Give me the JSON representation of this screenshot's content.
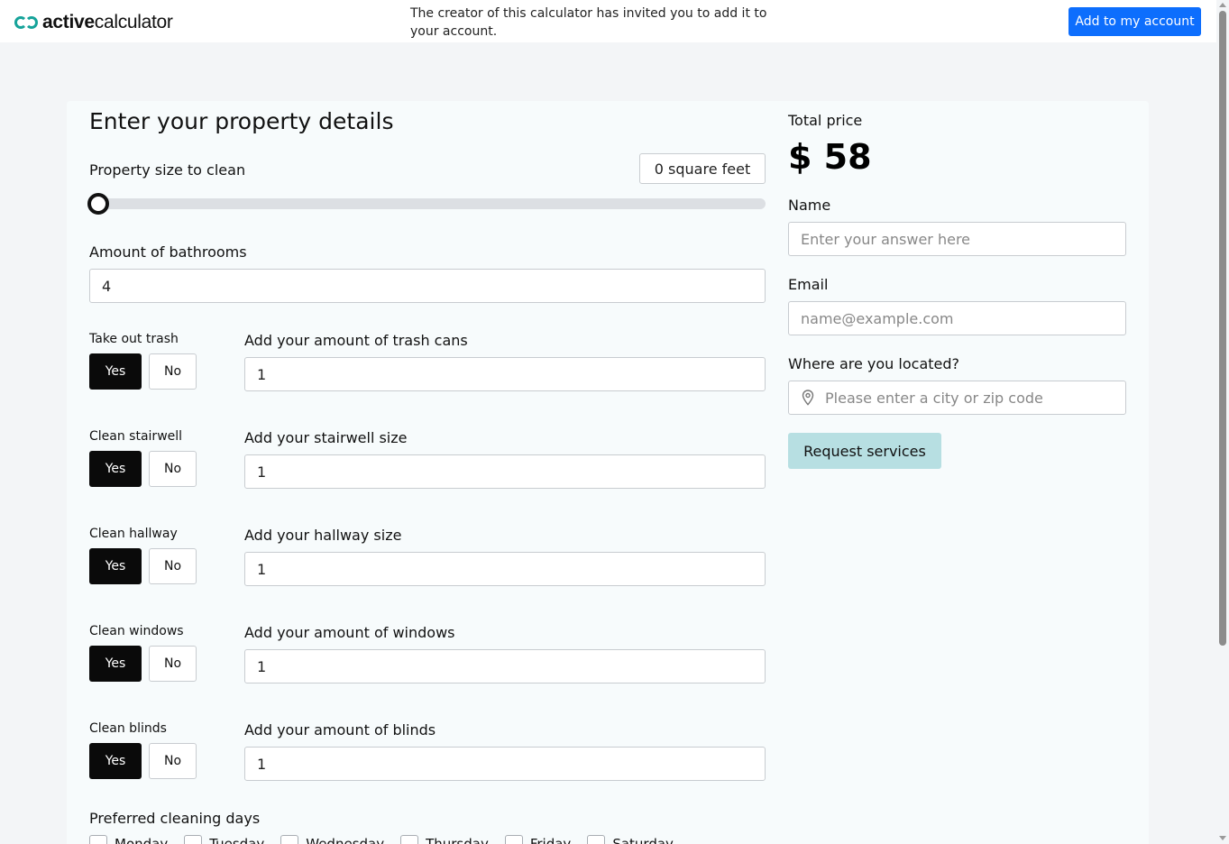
{
  "topbar": {
    "logo_bold": "active",
    "logo_light": "calculator",
    "notice": "The creator of this calculator has invited you to add it to your account.",
    "add_button": "Add to my account"
  },
  "form": {
    "heading": "Enter your property details",
    "property_size": {
      "label": "Property size to clean",
      "value": "0 square feet",
      "slider_fraction": 0
    },
    "bathrooms": {
      "label": "Amount of bathrooms",
      "value": "4"
    },
    "toggles": [
      {
        "question": "Take out trash",
        "yes": "Yes",
        "no": "No",
        "selected": "Yes",
        "field_label": "Add your amount of trash cans",
        "field_value": "1"
      },
      {
        "question": "Clean stairwell",
        "yes": "Yes",
        "no": "No",
        "selected": "Yes",
        "field_label": "Add your stairwell size",
        "field_value": "1"
      },
      {
        "question": "Clean hallway",
        "yes": "Yes",
        "no": "No",
        "selected": "Yes",
        "field_label": "Add your hallway size",
        "field_value": "1"
      },
      {
        "question": "Clean windows",
        "yes": "Yes",
        "no": "No",
        "selected": "Yes",
        "field_label": "Add your amount of windows",
        "field_value": "1"
      },
      {
        "question": "Clean blinds",
        "yes": "Yes",
        "no": "No",
        "selected": "Yes",
        "field_label": "Add your amount of blinds",
        "field_value": "1"
      }
    ],
    "days_label": "Preferred cleaning days",
    "days": [
      "Monday",
      "Tuesday",
      "Wednesday",
      "Thursday",
      "Friday",
      "Saturday"
    ]
  },
  "summary": {
    "total_label": "Total price",
    "total_value": "$ 58",
    "name_label": "Name",
    "name_placeholder": "Enter your answer here",
    "email_label": "Email",
    "email_placeholder": "name@example.com",
    "location_label": "Where are you located?",
    "location_placeholder": "Please enter a city or zip code",
    "request_button": "Request services"
  },
  "colors": {
    "accent_blue": "#0d6efd",
    "logo_teal": "#16a39a",
    "request_button": "#b7dfe2",
    "selected_toggle": "#0a0a0a"
  }
}
